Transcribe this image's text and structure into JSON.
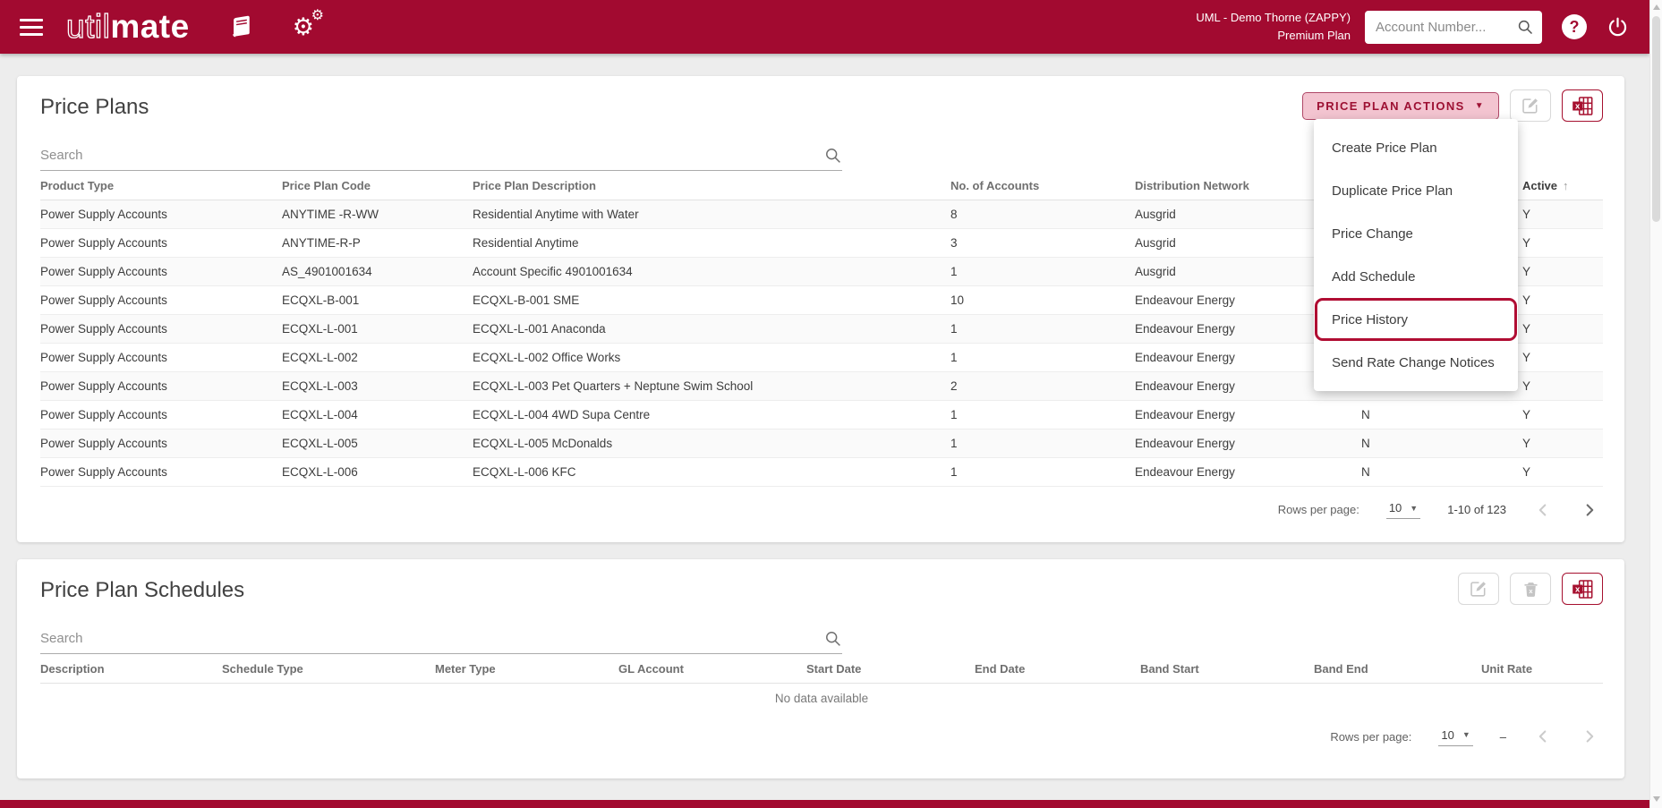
{
  "colors": {
    "header_red": "#A20A30",
    "accent": "#A6102F",
    "button_pink": "#F3C4D0",
    "highlight_ring": "#B00D33"
  },
  "icons": {
    "menu_caret": "▼",
    "select_caret": "▼",
    "sort_asc": "↑",
    "gear": "⚙"
  },
  "topbar": {
    "brand_util": "util",
    "brand_mate": "mate",
    "org_line": "UML - Demo Thorne (ZAPPY)",
    "plan_line": "Premium Plan",
    "account_search_placeholder": "Account Number..."
  },
  "price_plans": {
    "title": "Price Plans",
    "actions_button_label": "PRICE PLAN ACTIONS",
    "search_placeholder": "Search",
    "columns": {
      "product_type": "Product Type",
      "code": "Price Plan Code",
      "description": "Price Plan Description",
      "accounts": "No. of Accounts",
      "network": "Distribution Network",
      "active": "Active"
    },
    "rows": [
      {
        "product_type": "Power Supply Accounts",
        "code": "ANYTIME -R-WW",
        "description": "Residential Anytime with Water",
        "accounts": "8",
        "network": "Ausgrid",
        "flag": "",
        "active": "Y"
      },
      {
        "product_type": "Power Supply Accounts",
        "code": "ANYTIME-R-P",
        "description": "Residential Anytime",
        "accounts": "3",
        "network": "Ausgrid",
        "flag": "",
        "active": "Y"
      },
      {
        "product_type": "Power Supply Accounts",
        "code": "AS_4901001634",
        "description": "Account Specific 4901001634",
        "accounts": "1",
        "network": "Ausgrid",
        "flag": "",
        "active": "Y"
      },
      {
        "product_type": "Power Supply Accounts",
        "code": "ECQXL-B-001",
        "description": "ECQXL-B-001 SME",
        "accounts": "10",
        "network": "Endeavour Energy",
        "flag": "",
        "active": "Y"
      },
      {
        "product_type": "Power Supply Accounts",
        "code": "ECQXL-L-001",
        "description": "ECQXL-L-001 Anaconda",
        "accounts": "1",
        "network": "Endeavour Energy",
        "flag": "",
        "active": "Y"
      },
      {
        "product_type": "Power Supply Accounts",
        "code": "ECQXL-L-002",
        "description": "ECQXL-L-002 Office Works",
        "accounts": "1",
        "network": "Endeavour Energy",
        "flag": "",
        "active": "Y"
      },
      {
        "product_type": "Power Supply Accounts",
        "code": "ECQXL-L-003",
        "description": "ECQXL-L-003 Pet Quarters + Neptune Swim School",
        "accounts": "2",
        "network": "Endeavour Energy",
        "flag": "",
        "active": "Y"
      },
      {
        "product_type": "Power Supply Accounts",
        "code": "ECQXL-L-004",
        "description": "ECQXL-L-004 4WD Supa Centre",
        "accounts": "1",
        "network": "Endeavour Energy",
        "flag": "N",
        "active": "Y"
      },
      {
        "product_type": "Power Supply Accounts",
        "code": "ECQXL-L-005",
        "description": "ECQXL-L-005 McDonalds",
        "accounts": "1",
        "network": "Endeavour Energy",
        "flag": "N",
        "active": "Y"
      },
      {
        "product_type": "Power Supply Accounts",
        "code": "ECQXL-L-006",
        "description": "ECQXL-L-006 KFC",
        "accounts": "1",
        "network": "Endeavour Energy",
        "flag": "N",
        "active": "Y"
      }
    ],
    "pagination": {
      "rows_per_page_label": "Rows per page:",
      "rows_per_page_value": "10",
      "range_label": "1-10 of 123"
    }
  },
  "actions_menu": {
    "items": [
      "Create Price Plan",
      "Duplicate Price Plan",
      "Price Change",
      "Add Schedule",
      "Price History",
      "Send Rate Change Notices"
    ],
    "highlighted_item": "Price History"
  },
  "schedules": {
    "title": "Price Plan Schedules",
    "search_placeholder": "Search",
    "columns": [
      "Description",
      "Schedule Type",
      "Meter Type",
      "GL Account",
      "Start Date",
      "End Date",
      "Band Start",
      "Band End",
      "Unit Rate"
    ],
    "empty_message": "No data available",
    "pagination": {
      "rows_per_page_label": "Rows per page:",
      "rows_per_page_value": "10",
      "range_label": "–"
    }
  }
}
